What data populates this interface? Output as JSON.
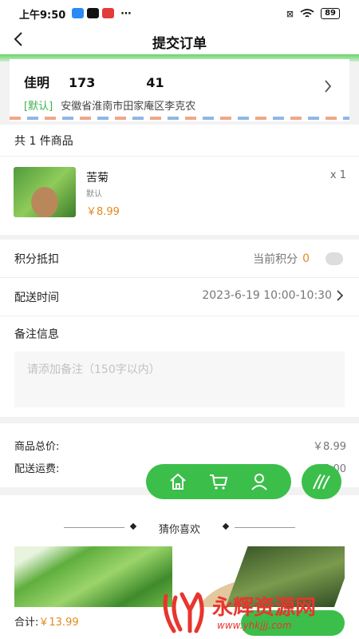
{
  "status_bar": {
    "time": "上午9:50",
    "icons": [
      "app-notification-icon",
      "tiktok-icon",
      "app-badge-icon",
      "more-dots-icon"
    ],
    "right_icons": [
      "sim-off-icon",
      "wifi-icon"
    ],
    "battery": "89"
  },
  "header": {
    "title": "提交订单",
    "back_icon": "back-arrow-icon"
  },
  "address": {
    "name": "佳明",
    "phone": "173　　　　41",
    "tag": "[默认]",
    "detail": "安徽省淮南市田家庵区李克农"
  },
  "goods": {
    "count_label": "共 1 件商品",
    "items": [
      {
        "name": "苦菊",
        "spec": "默认",
        "price": "￥8.99",
        "qty": "x 1"
      }
    ]
  },
  "form": {
    "points_label": "积分抵扣",
    "points_current_label": "当前积分",
    "points_value": "0",
    "delivery_label": "配送时间",
    "delivery_value": "2023-6-19 10:00-10:30",
    "remark_label": "备注信息",
    "remark_placeholder": "请添加备注（150字以内）"
  },
  "totals": {
    "goods_total_label": "商品总价:",
    "goods_total_value": "￥8.99",
    "shipping_label": "配送运费:",
    "shipping_value": "￥5.00"
  },
  "recommend": {
    "title": "猜你喜欢"
  },
  "floating_nav": {
    "icons": [
      "home-icon",
      "cart-icon",
      "user-icon",
      "leaf-icon"
    ]
  },
  "bottom_bar": {
    "total_label": "合计:",
    "total_value": "￥13.99"
  },
  "watermark": {
    "text": "永辉资源网",
    "url": "www.yhkjjj.com"
  },
  "colors": {
    "accent": "#3bbf4a",
    "price": "#e08a1e",
    "watermark": "#e8352d"
  }
}
